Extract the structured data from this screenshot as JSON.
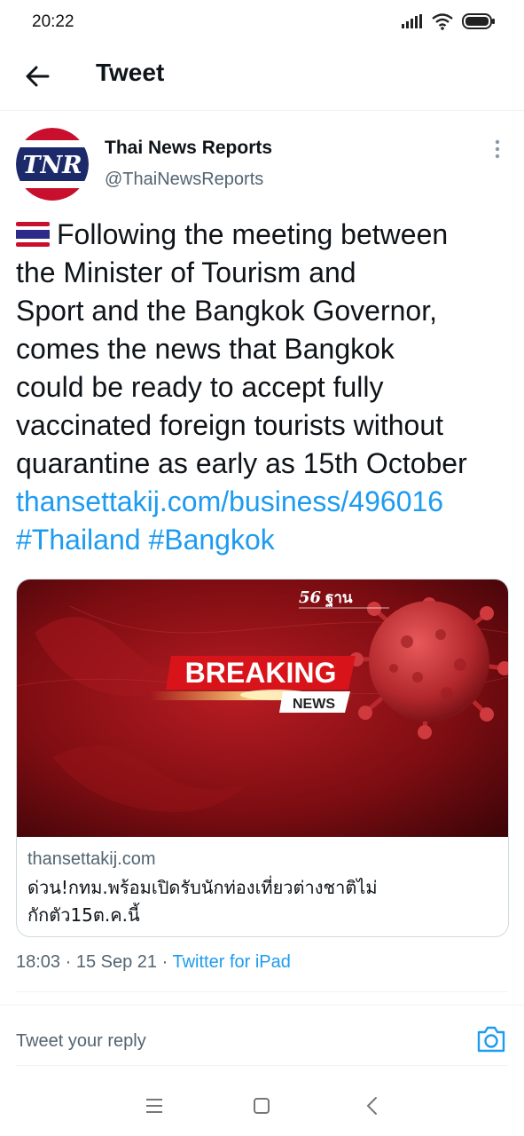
{
  "status_bar": {
    "time": "20:22",
    "icons": [
      "signal-icon",
      "wifi-icon",
      "battery-icon"
    ]
  },
  "header": {
    "back_icon": "back-arrow-icon",
    "title": "Tweet"
  },
  "tweet": {
    "author": {
      "avatar_text": "TNR",
      "name": "Thai News Reports",
      "handle": "@ThaiNewsReports"
    },
    "more_icon": "more-vertical-icon",
    "flag_emoji": "thailand-flag-emoji",
    "text_lines": [
      "Following the meeting between",
      "the Minister of Tourism and",
      "Sport and the Bangkok Governor,",
      "comes the news that Bangkok",
      "could be ready to accept fully",
      "vaccinated foreign tourists without",
      "quarantine as early as 15th October"
    ],
    "link": "thansettakij.com/business/496016",
    "hashtags": [
      "#Thailand",
      "#Bangkok"
    ],
    "card": {
      "image_logo": "ฐาน",
      "image_breaking": "BREAKING",
      "image_news": "NEWS",
      "domain": "thansettakij.com",
      "title_lines": [
        "ด่วน!กทม.พร้อมเปิดรับนักท่องเที่ยวต่างชาติไม่",
        "กักตัว15ต.ค.นี้"
      ]
    },
    "time": "18:03",
    "date": "15 Sep 21",
    "separator": "·",
    "source": "Twitter for iPad"
  },
  "reply": {
    "placeholder": "Tweet your reply",
    "camera_icon": "camera-icon"
  },
  "nav_bar": {
    "icons": [
      "menu-icon",
      "home-square-icon",
      "back-chevron-icon"
    ]
  },
  "colors": {
    "link": "#1d9bf0",
    "secondary_text": "#536471",
    "primary_text": "#0f1419",
    "card_red": "#a3141b"
  }
}
